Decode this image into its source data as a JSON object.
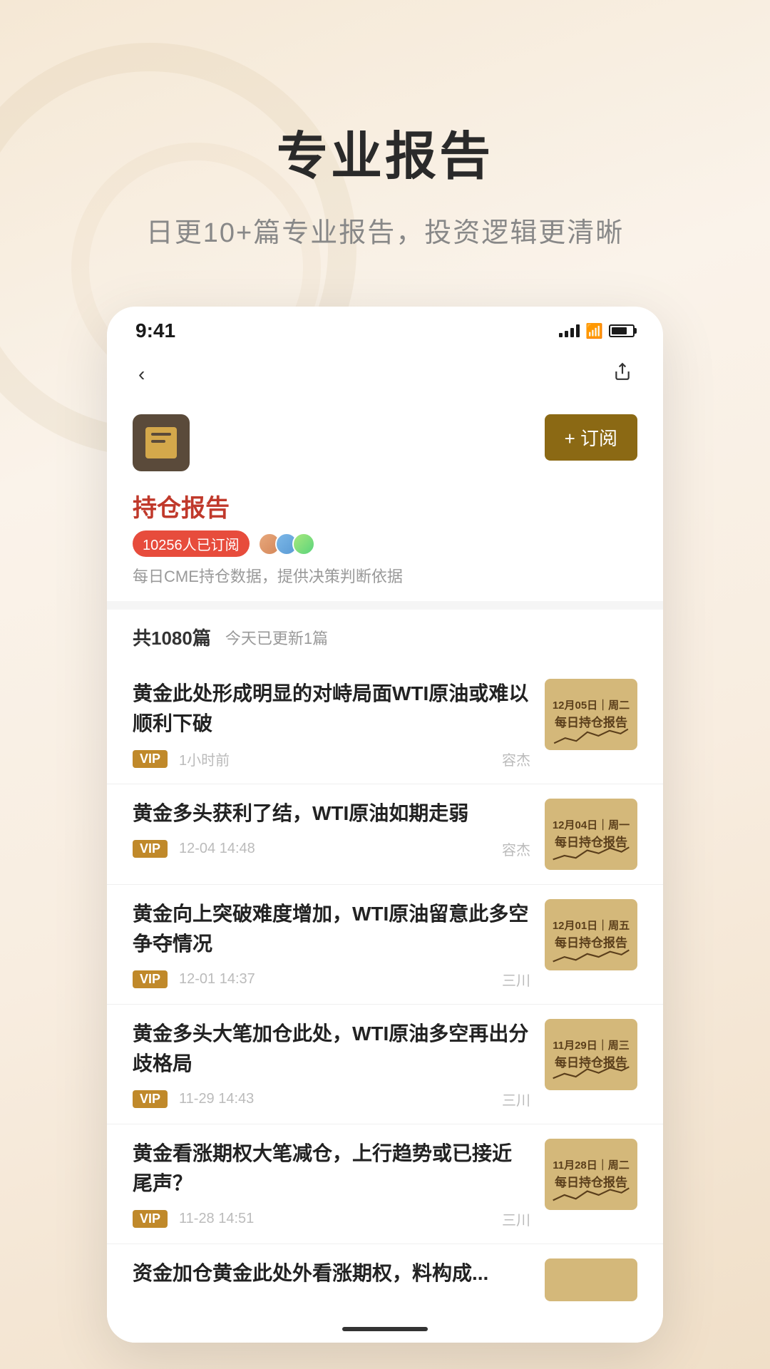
{
  "page": {
    "title": "专业报告",
    "subtitle": "日更10+篇专业报告，投资逻辑更清晰"
  },
  "status_bar": {
    "time": "9:41",
    "signal": "signal",
    "wifi": "wifi",
    "battery": "battery"
  },
  "nav": {
    "back": "‹",
    "share": "⬆"
  },
  "channel": {
    "name": "持仓报告",
    "desc": "每日CME持仓数据，提供决策判断依据",
    "subscribers_text": "10256人已订阅",
    "subscribe_label": "+ 订阅",
    "total_count_text": "共1080篇",
    "today_update_text": "今天已更新1篇"
  },
  "articles": [
    {
      "title": "黄金此处形成明显的对峙局面WTI原油或难以顺利下破",
      "vip": "VIP",
      "time": "1小时前",
      "author": "容杰",
      "thumb_date": "12月05日｜周二",
      "thumb_title": "每日持仓报告"
    },
    {
      "title": "黄金多头获利了结，WTI原油如期走弱",
      "vip": "VIP",
      "time": "12-04 14:48",
      "author": "容杰",
      "thumb_date": "12月04日｜周一",
      "thumb_title": "每日持仓报告"
    },
    {
      "title": "黄金向上突破难度增加，WTI原油留意此多空争夺情况",
      "vip": "VIP",
      "time": "12-01 14:37",
      "author": "三川",
      "thumb_date": "12月01日｜周五",
      "thumb_title": "每日持仓报告"
    },
    {
      "title": "黄金多头大笔加仓此处，WTI原油多空再出分歧格局",
      "vip": "VIP",
      "time": "11-29 14:43",
      "author": "三川",
      "thumb_date": "11月29日｜周三",
      "thumb_title": "每日持仓报告"
    },
    {
      "title": "黄金看涨期权大笔减仓，上行趋势或已接近尾声？",
      "vip": "VIP",
      "time": "11-28 14:51",
      "author": "三川",
      "thumb_date": "11月28日｜周二",
      "thumb_title": "每日持仓报告"
    }
  ],
  "partial_article": {
    "title": "资金加仓黄金此处外看涨期权，料构成..."
  },
  "colors": {
    "accent": "#8b6914",
    "vip_bg": "#c0892a",
    "name_color": "#c0392b",
    "badge_bg": "#e74c3c",
    "thumb_bg": "#d4b87a",
    "thumb_text": "#5a3e1b"
  }
}
